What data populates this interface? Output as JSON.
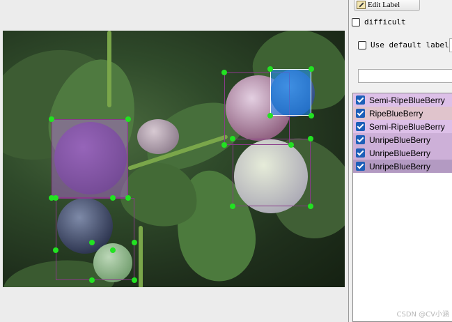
{
  "panel": {
    "edit_label_button": "Edit Label",
    "difficult_label": "difficult",
    "use_default_label": "Use default label",
    "label_input_value": ""
  },
  "labels": [
    {
      "text": "Semi-RipeBlueBerry",
      "color": "#ddc0e8",
      "checked": true
    },
    {
      "text": "RipeBlueBerry",
      "color": "#e0c4cc",
      "checked": true
    },
    {
      "text": "Semi-RipeBlueBerry",
      "color": "#ddc0e8",
      "checked": true
    },
    {
      "text": "UnripeBlueBerry",
      "color": "#cdb0d8",
      "checked": true
    },
    {
      "text": "UnripeBlueBerry",
      "color": "#cdb0d8",
      "checked": true
    },
    {
      "text": "UnripeBlueBerry",
      "color": "#b39ac2",
      "checked": true
    }
  ],
  "watermark": "CSDN @CV小涵",
  "colors": {
    "handle": "#22e222",
    "selected_box_fill": "#1e90ff",
    "ripe_box_fill": "#b06ad0",
    "box_border": "#8a3a8a"
  }
}
